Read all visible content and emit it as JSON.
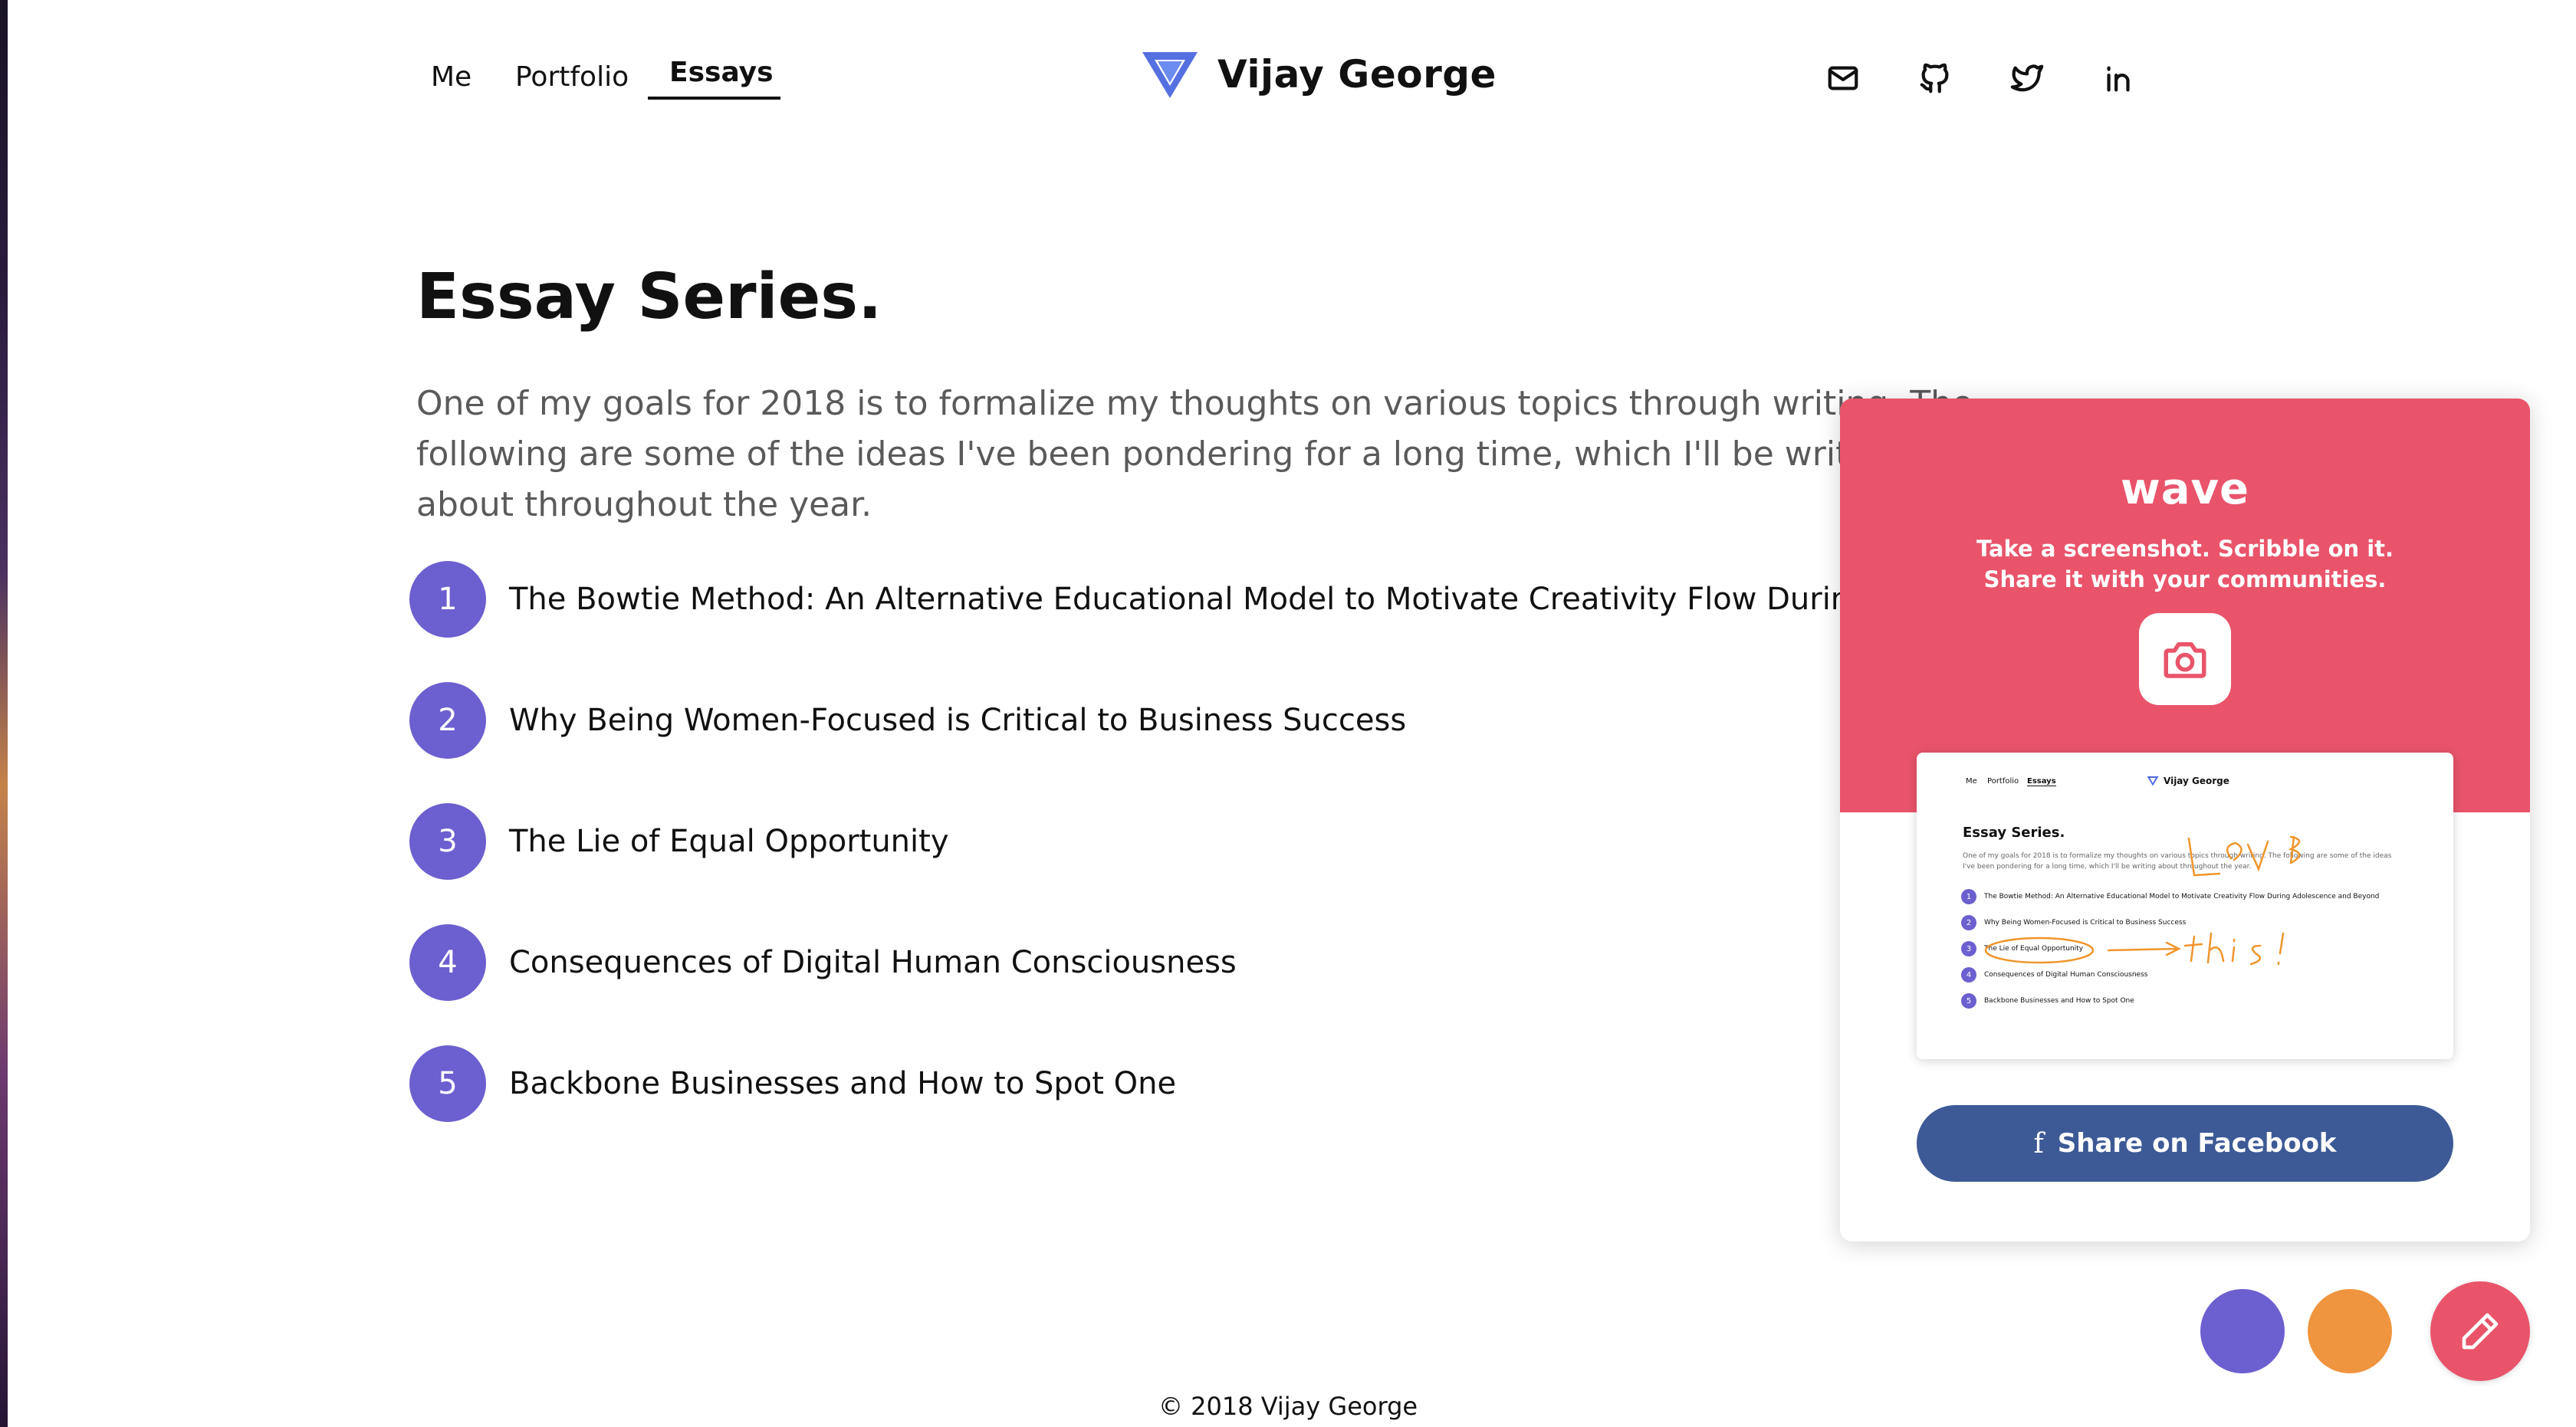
{
  "nav": {
    "items": [
      {
        "label": "Me"
      },
      {
        "label": "Portfolio"
      },
      {
        "label": "Essays"
      }
    ],
    "brand": "Vijay George",
    "social_icons": [
      "mail-icon",
      "github-icon",
      "twitter-icon",
      "linkedin-icon"
    ]
  },
  "main": {
    "heading": "Essay Series.",
    "intro": "One of my goals for 2018 is to formalize my thoughts on various topics through writing. The following are some of the ideas I've been pondering for a long time, which I'll be writing about throughout the year.",
    "essays": [
      {
        "num": "1",
        "title": "The Bowtie Method: An Alternative Educational Model to Motivate Creativity Flow During Adolescence and Beyond"
      },
      {
        "num": "2",
        "title": "Why Being Women-Focused is Critical to Business Success"
      },
      {
        "num": "3",
        "title": "The Lie of Equal Opportunity"
      },
      {
        "num": "4",
        "title": "Consequences of Digital Human Consciousness"
      },
      {
        "num": "5",
        "title": "Backbone Businesses and How to Spot One"
      }
    ]
  },
  "footer": {
    "text": "© 2018 Vijay George"
  },
  "wave": {
    "logo": "wave",
    "tagline": "Take a screenshot. Scribble on it. Share it with your communities.",
    "share_label": "Share on Facebook",
    "accent": "#e9546b",
    "facebook_color": "#3d5a96",
    "preview_scribble": [
      "LOVE",
      "this!"
    ]
  },
  "colors": {
    "number_circle": "#6c5fcf",
    "fab_orange": "#f0953f"
  }
}
